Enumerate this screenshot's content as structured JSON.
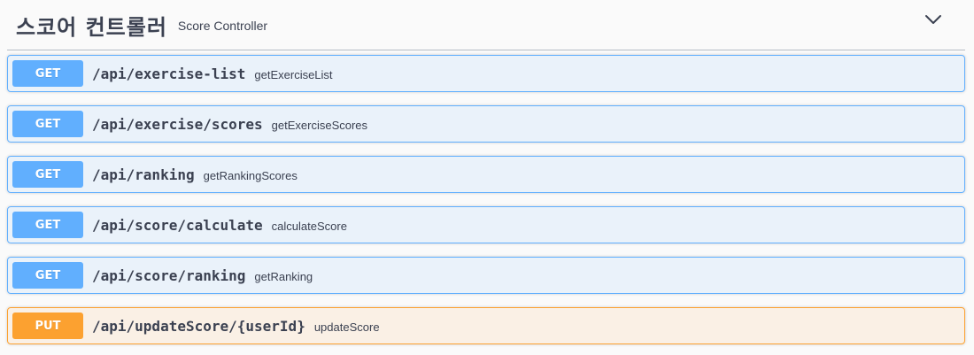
{
  "tag": {
    "title": "스코어 컨트롤러",
    "description": "Score Controller",
    "toggle_icon": "chevron-down-icon"
  },
  "colors": {
    "get": "#61affe",
    "put": "#fca130",
    "text": "#3b4151"
  },
  "operations": [
    {
      "method": "GET",
      "path": "/api/exercise-list",
      "summary": "getExerciseList"
    },
    {
      "method": "GET",
      "path": "/api/exercise/scores",
      "summary": "getExerciseScores"
    },
    {
      "method": "GET",
      "path": "/api/ranking",
      "summary": "getRankingScores"
    },
    {
      "method": "GET",
      "path": "/api/score/calculate",
      "summary": "calculateScore"
    },
    {
      "method": "GET",
      "path": "/api/score/ranking",
      "summary": "getRanking"
    },
    {
      "method": "PUT",
      "path": "/api/updateScore/{userId}",
      "summary": "updateScore"
    }
  ]
}
